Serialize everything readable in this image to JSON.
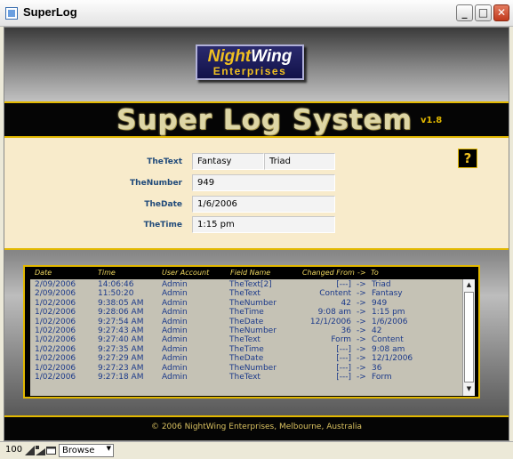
{
  "window": {
    "title": "SuperLog"
  },
  "logo": {
    "night": "Night",
    "wing": "Wing",
    "sub": "Enterprises"
  },
  "banner": {
    "title": "Super Log System",
    "version": "v1.8"
  },
  "help_button": {
    "label": "?"
  },
  "form": {
    "text_label": "TheText",
    "text_value1": "Fantasy",
    "text_value2": "Triad",
    "number_label": "TheNumber",
    "number_value": "949",
    "date_label": "TheDate",
    "date_value": "1/6/2006",
    "time_label": "TheTime",
    "time_value": "1:15 pm"
  },
  "log": {
    "headers": {
      "date": "Date",
      "time": "Time",
      "user": "User Account",
      "field": "Field Name",
      "from": "Changed From",
      "arrow": "->",
      "to": "To"
    },
    "rows": [
      {
        "date": "2/09/2006",
        "time": "14:06:46",
        "user": "Admin",
        "field": "TheText[2]",
        "from": "[---]",
        "to": "Triad"
      },
      {
        "date": "2/09/2006",
        "time": "11:50:20",
        "user": "Admin",
        "field": "TheText",
        "from": "Content",
        "to": "Fantasy"
      },
      {
        "date": "1/02/2006",
        "time": "9:38:05 AM",
        "user": "Admin",
        "field": "TheNumber",
        "from": "42",
        "to": "949"
      },
      {
        "date": "1/02/2006",
        "time": "9:28:06 AM",
        "user": "Admin",
        "field": "TheTime",
        "from": "9:08 am",
        "to": "1:15 pm"
      },
      {
        "date": "1/02/2006",
        "time": "9:27:54 AM",
        "user": "Admin",
        "field": "TheDate",
        "from": "12/1/2006",
        "to": "1/6/2006"
      },
      {
        "date": "1/02/2006",
        "time": "9:27:43 AM",
        "user": "Admin",
        "field": "TheNumber",
        "from": "36",
        "to": "42"
      },
      {
        "date": "1/02/2006",
        "time": "9:27:40 AM",
        "user": "Admin",
        "field": "TheText",
        "from": "Form",
        "to": "Content"
      },
      {
        "date": "1/02/2006",
        "time": "9:27:35 AM",
        "user": "Admin",
        "field": "TheTime",
        "from": "[---]",
        "to": "9:08 am"
      },
      {
        "date": "1/02/2006",
        "time": "9:27:29 AM",
        "user": "Admin",
        "field": "TheDate",
        "from": "[---]",
        "to": "12/1/2006"
      },
      {
        "date": "1/02/2006",
        "time": "9:27:23 AM",
        "user": "Admin",
        "field": "TheNumber",
        "from": "[---]",
        "to": "36"
      },
      {
        "date": "1/02/2006",
        "time": "9:27:18 AM",
        "user": "Admin",
        "field": "TheText",
        "from": "[---]",
        "to": "Form"
      }
    ]
  },
  "footer": {
    "text": "© 2006 NightWing Enterprises, Melbourne, Australia"
  },
  "statusbar": {
    "zoom": "100",
    "mode": "Browse"
  },
  "colors": {
    "accent_gold": "#e2b800",
    "label_blue": "#204a7a",
    "log_text": "#1c3a8a",
    "form_bg": "#f8ebcb"
  },
  "icons": [
    "app-icon",
    "minimize-icon",
    "maximize-icon",
    "close-icon",
    "help-icon",
    "zoom-out-icon",
    "zoom-in-icon",
    "layout-icon",
    "dropdown-arrow-icon",
    "scroll-up-icon",
    "scroll-down-icon"
  ]
}
